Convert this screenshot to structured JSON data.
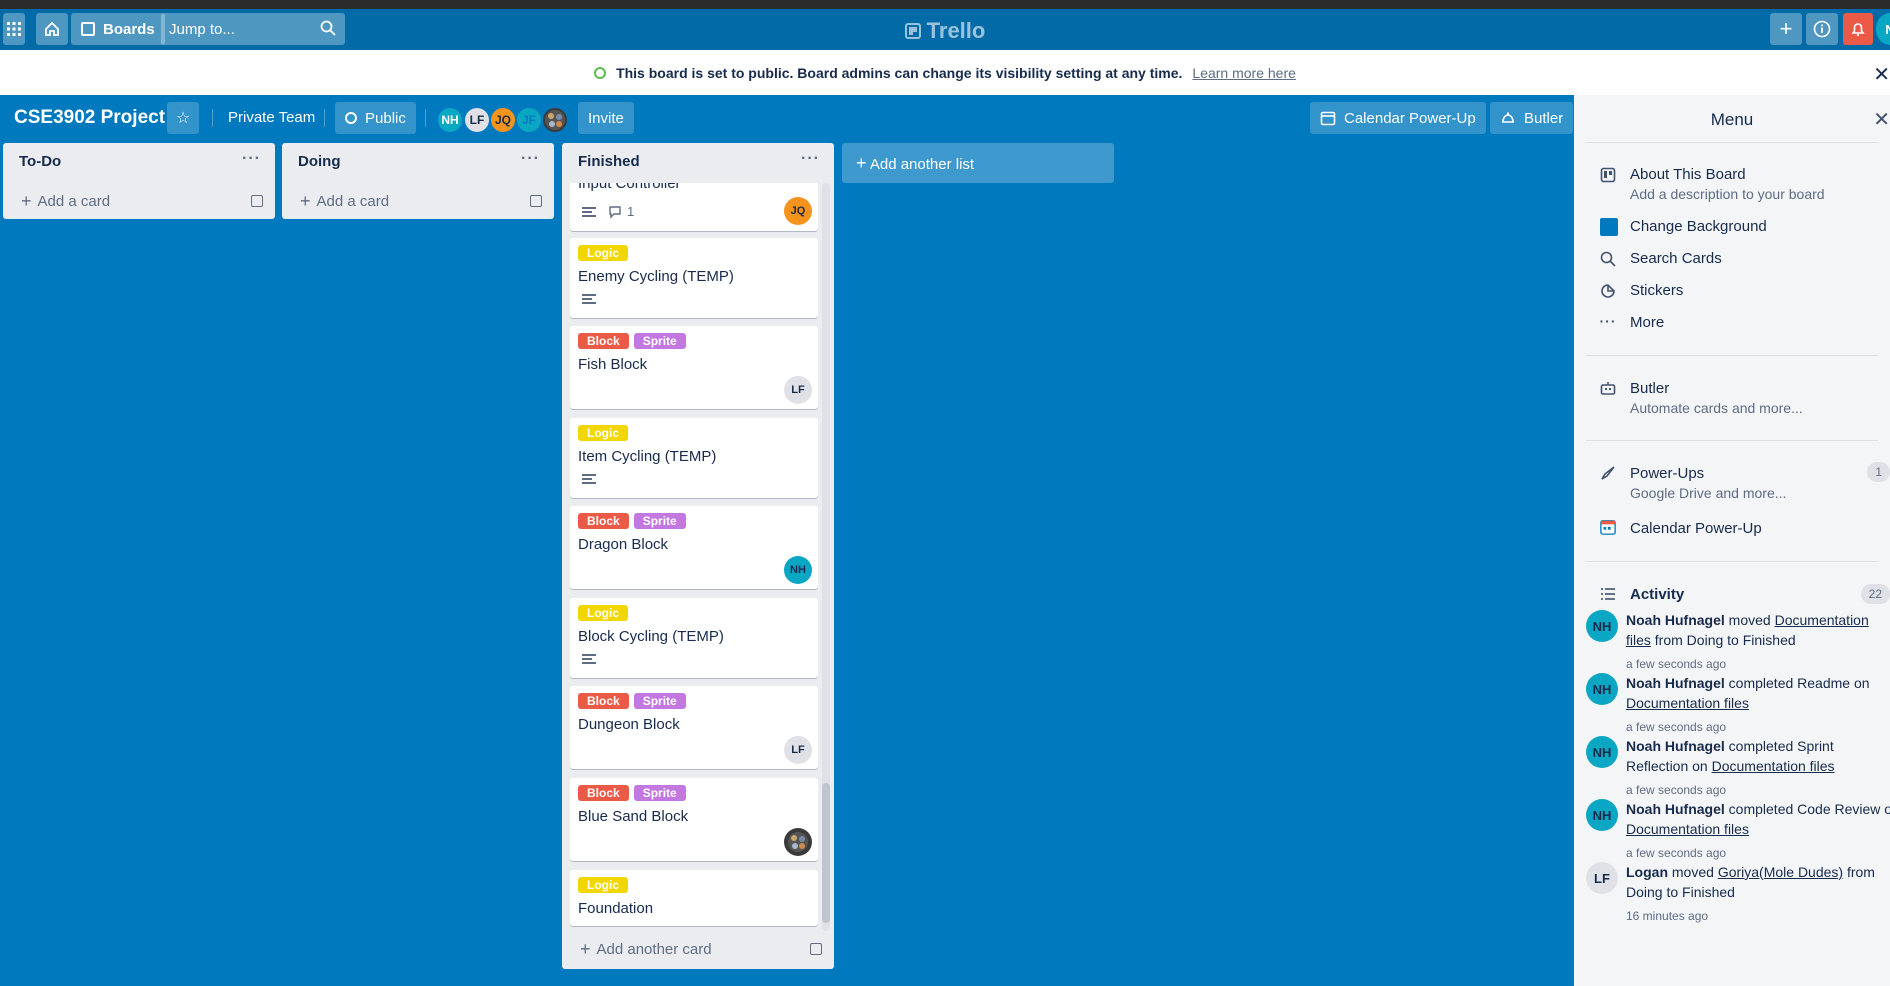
{
  "topbar": {
    "apps_icon": "apps-grid-icon",
    "home_icon": "home-icon",
    "boards_label": "Boards",
    "jump_placeholder": "Jump to...",
    "brand": "Trello",
    "user_initial": "N"
  },
  "banner": {
    "message": "This board is set to public. Board admins can change its visibility setting at any time.",
    "link": "Learn more here"
  },
  "board": {
    "title": "CSE3902 Project",
    "team": "Private Team",
    "visibility": "Public",
    "invite": "Invite",
    "members": [
      {
        "initials": "NH",
        "bg": "#0aa7c4",
        "fg": "#ffffff"
      },
      {
        "initials": "LF",
        "bg": "#dfe1e6",
        "fg": "#172b4d"
      },
      {
        "initials": "JQ",
        "bg": "#f6931d",
        "fg": "#172b4d"
      },
      {
        "initials": "JF",
        "bg": "#0aa7c4",
        "fg": "#0079bf"
      }
    ],
    "calendar_powerup": "Calendar Power-Up",
    "butler": "Butler"
  },
  "lists": [
    {
      "name": "To-Do",
      "add_card": "Add a card"
    },
    {
      "name": "Doing",
      "add_card": "Add a card"
    },
    {
      "name": "Finished",
      "add_card": "Add another card",
      "cards": [
        {
          "title": "Input Controller",
          "labels": [],
          "comments": "1",
          "member": "JQ"
        },
        {
          "title": "Enemy Cycling (TEMP)",
          "labels": [
            "Logic"
          ]
        },
        {
          "title": "Fish Block",
          "labels": [
            "Block",
            "Sprite"
          ],
          "member": "LF"
        },
        {
          "title": "Item Cycling (TEMP)",
          "labels": [
            "Logic"
          ]
        },
        {
          "title": "Dragon Block",
          "labels": [
            "Block",
            "Sprite"
          ],
          "member": "NH"
        },
        {
          "title": "Block Cycling (TEMP)",
          "labels": [
            "Logic"
          ]
        },
        {
          "title": "Dungeon Block",
          "labels": [
            "Block",
            "Sprite"
          ],
          "member": "LF"
        },
        {
          "title": "Blue Sand Block",
          "labels": [
            "Block",
            "Sprite"
          ]
        },
        {
          "title": "Foundation",
          "labels": [
            "Logic"
          ]
        }
      ]
    }
  ],
  "add_list": "Add another list",
  "label_colors": {
    "Logic": "#f2d600",
    "Block": "#eb5a46",
    "Sprite": "#c377e0"
  },
  "menu": {
    "title": "Menu",
    "about_title": "About This Board",
    "about_sub": "Add a description to your board",
    "change_background": "Change Background",
    "search_cards": "Search Cards",
    "stickers": "Stickers",
    "more": "More",
    "butler_title": "Butler",
    "butler_sub": "Automate cards and more...",
    "powerups_title": "Power-Ups",
    "powerups_sub": "Google Drive and more...",
    "powerups_count": "1",
    "calendar": "Calendar Power-Up",
    "activity_title": "Activity",
    "activity_count": "22",
    "activity": [
      {
        "initials": "NH",
        "user": "Noah Hufnagel",
        "line1": "moved",
        "link1": "Documentation",
        "line2_link": "files",
        "line2": "from Doing to Finished",
        "time": "a few seconds ago"
      },
      {
        "initials": "NH",
        "user": "Noah Hufnagel",
        "line1": "completed Readme on",
        "line2_link": "Documentation files",
        "time": "a few seconds ago"
      },
      {
        "initials": "NH",
        "user": "Noah Hufnagel",
        "line1": "completed Sprint",
        "line2": "Reflection on",
        "line2_link": "Documentation files",
        "time": "a few seconds ago"
      },
      {
        "initials": "NH",
        "user": "Noah Hufnagel",
        "line1": "completed Code Review o",
        "line2_link": "Documentation files",
        "time": "a few seconds ago"
      },
      {
        "initials": "LF",
        "user": "Logan",
        "line1": "moved",
        "link1": "Goriya(Mole Dudes)",
        "line1_after": "from",
        "line2": "Doing to Finished",
        "time": "16 minutes ago"
      }
    ]
  }
}
